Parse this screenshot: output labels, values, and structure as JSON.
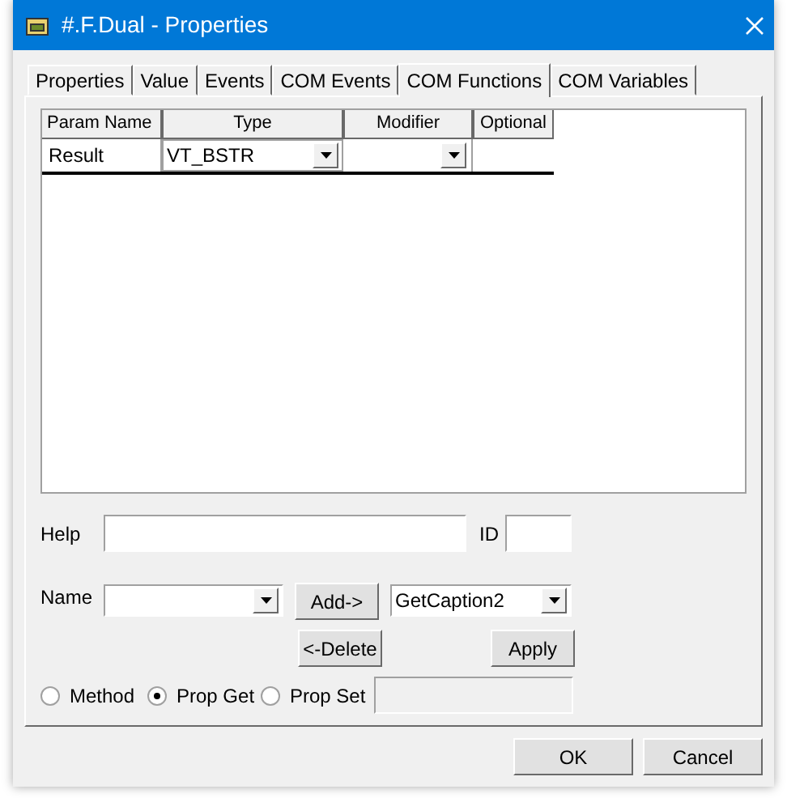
{
  "window": {
    "title": "#.F.Dual - Properties"
  },
  "tabs": [
    {
      "label": "Properties",
      "selected": false
    },
    {
      "label": "Value",
      "selected": false
    },
    {
      "label": "Events",
      "selected": false
    },
    {
      "label": "COM Events",
      "selected": false
    },
    {
      "label": "COM Functions",
      "selected": true
    },
    {
      "label": "COM Variables",
      "selected": false
    }
  ],
  "grid": {
    "columns": [
      "Param Name",
      "Type",
      "Modifier",
      "Optional"
    ],
    "rows": [
      {
        "param_name": "Result",
        "type": "VT_BSTR"
      }
    ]
  },
  "help": {
    "label": "Help"
  },
  "id": {
    "label": "ID"
  },
  "name": {
    "label": "Name"
  },
  "add_button": "Add->",
  "delete_button": "<-Delete",
  "function_combo": {
    "value": "GetCaption2"
  },
  "apply_button": "Apply",
  "radios": [
    {
      "label": "Method",
      "selected": false
    },
    {
      "label": "Prop Get",
      "selected": true
    },
    {
      "label": "Prop Set",
      "selected": false
    }
  ],
  "buttons": [
    "OK",
    "Cancel"
  ]
}
